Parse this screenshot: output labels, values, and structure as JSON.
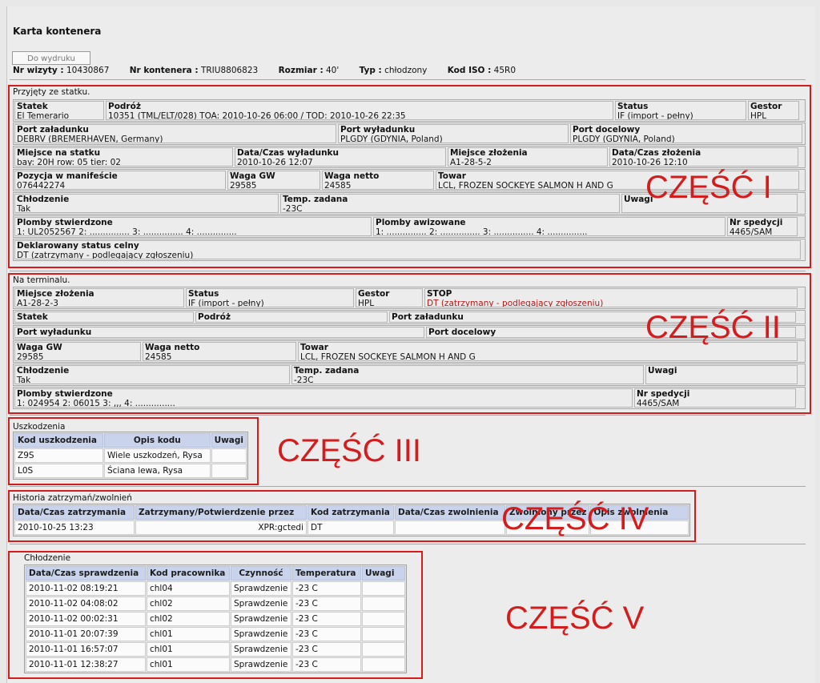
{
  "title": "Karta kontenera",
  "print_button": "Do wydruku",
  "info": {
    "visit_label": "Nr wizyty :",
    "visit_value": "10430867",
    "container_label": "Nr kontenera :",
    "container_value": "TRIU8806823",
    "size_label": "Rozmiar :",
    "size_value": "40'",
    "type_label": "Typ :",
    "type_value": "chłodzony",
    "iso_label": "Kod ISO :",
    "iso_value": "45R0"
  },
  "labels": {
    "part1": "CZĘŚĆ I",
    "part2": "CZĘŚĆ II",
    "part3": "CZĘŚĆ III",
    "part4": "CZĘŚĆ IV",
    "part5": "CZĘŚĆ V"
  },
  "ship": {
    "title": "Przyjęty ze statku.",
    "statek_l": "Statek",
    "statek_v": "El Temerario",
    "podroz_l": "Podróż",
    "podroz_v": "10351 (TML/ELT/028) TOA: 2010-10-26 06:00 / TOD: 2010-10-26 22:35",
    "status_l": "Status",
    "status_v": "IF (import - pełny)",
    "gestor_l": "Gestor",
    "gestor_v": "HPL",
    "port_zal_l": "Port załadunku",
    "port_zal_v": "DEBRV (BREMERHAVEN, Germany)",
    "port_wyl_l": "Port wyładunku",
    "port_wyl_v": "PLGDY (GDYNIA, Poland)",
    "port_doc_l": "Port docelowy",
    "port_doc_v": "PLGDY (GDYNIA, Poland)",
    "miejsce_l": "Miejsce na statku",
    "miejsce_v": "bay: 20H row: 05 tier: 02",
    "dc_wyl_l": "Data/Czas wyładunku",
    "dc_wyl_v": "2010-10-26 12:07",
    "miejsce_zl_l": "Miejsce złożenia",
    "miejsce_zl_v": "A1-28-5-2",
    "dc_zl_l": "Data/Czas złożenia",
    "dc_zl_v": "2010-10-26 12:10",
    "poz_l": "Pozycja w manifeście",
    "poz_v": "076442274",
    "gw_l": "Waga GW",
    "gw_v": "29585",
    "netto_l": "Waga netto",
    "netto_v": "24585",
    "towar_l": "Towar",
    "towar_v": "LCL, FROZEN SOCKEYE SALMON H AND G",
    "chl_l": "Chłodzenie",
    "chl_v": "Tak",
    "temp_l": "Temp. zadana",
    "temp_v": "-23C",
    "uwagi_l": "Uwagi",
    "plomby_l": "Plomby stwierdzone",
    "plomby_v": "1: UL2052567   2: ...............   3: ...............   4: ...............",
    "plomby_aw_l": "Plomby awizowane",
    "plomby_aw_v": "1: ...............   2: ...............   3: ...............   4: ...............",
    "spedycja_l": "Nr spedycji",
    "spedycja_v": "4465/SAM",
    "deklar_l": "Deklarowany status celny",
    "deklar_v": "DT (zatrzymany - podlegający zgłoszeniu)"
  },
  "terminal": {
    "title": "Na terminalu.",
    "miejsce_zl_l": "Miejsce złożenia",
    "miejsce_zl_v": "A1-28-2-3",
    "status_l": "Status",
    "status_v": "IF (import - pełny)",
    "gestor_l": "Gestor",
    "gestor_v": "HPL",
    "stop_l": "STOP",
    "stop_v": "DT (zatrzymany - podlegający zgłoszeniu)",
    "statek_l": "Statek",
    "podroz_l": "Podróż",
    "port_zal_l": "Port załadunku",
    "port_wyl_l": "Port wyładunku",
    "port_doc_l": "Port docelowy",
    "gw_l": "Waga GW",
    "gw_v": "29585",
    "netto_l": "Waga netto",
    "netto_v": "24585",
    "towar_l": "Towar",
    "towar_v": "LCL, FROZEN SOCKEYE SALMON H AND G",
    "chl_l": "Chłodzenie",
    "chl_v": "Tak",
    "temp_l": "Temp. zadana",
    "temp_v": "-23C",
    "uwagi_l": "Uwagi",
    "plomby_l": "Plomby stwierdzone",
    "plomby_v": "1: 024954   2: 06015   3: ,,,   4: ...............",
    "spedycja_l": "Nr spedycji",
    "spedycja_v": "4465/SAM"
  },
  "damage": {
    "title": "Uszkodzenia",
    "headers": [
      "Kod uszkodzenia",
      "Opis kodu",
      "Uwagi"
    ],
    "rows": [
      [
        "Z9S",
        "Wiele uszkodzeń, Rysa",
        ""
      ],
      [
        "L0S",
        "Ściana lewa, Rysa",
        ""
      ]
    ]
  },
  "history": {
    "title": "Historia zatrzymań/zwolnień",
    "headers": [
      "Data/Czas zatrzymania",
      "Zatrzymany/Potwierdzenie przez",
      "Kod zatrzymania",
      "Data/Czas zwolnienia",
      "Zwolniony przez",
      "Opis zwolnienia"
    ],
    "rows": [
      [
        "2010-10-25 13:23",
        "XPR:gctedi",
        "DT",
        "",
        "",
        ""
      ]
    ]
  },
  "cooling": {
    "title": "Chłodzenie",
    "headers": [
      "Data/Czas sprawdzenia",
      "Kod pracownika",
      "Czynność",
      "Temperatura",
      "Uwagi"
    ],
    "rows": [
      [
        "2010-11-02 08:19:21",
        "chl04",
        "Sprawdzenie",
        "-23 C",
        ""
      ],
      [
        "2010-11-02 04:08:02",
        "chl02",
        "Sprawdzenie",
        "-23 C",
        ""
      ],
      [
        "2010-11-02 00:02:31",
        "chl02",
        "Sprawdzenie",
        "-23 C",
        ""
      ],
      [
        "2010-11-01 20:07:39",
        "chl01",
        "Sprawdzenie",
        "-23 C",
        ""
      ],
      [
        "2010-11-01 16:57:07",
        "chl01",
        "Sprawdzenie",
        "-23 C",
        ""
      ],
      [
        "2010-11-01 12:38:27",
        "chl01",
        "Sprawdzenie",
        "-23 C",
        ""
      ]
    ]
  }
}
